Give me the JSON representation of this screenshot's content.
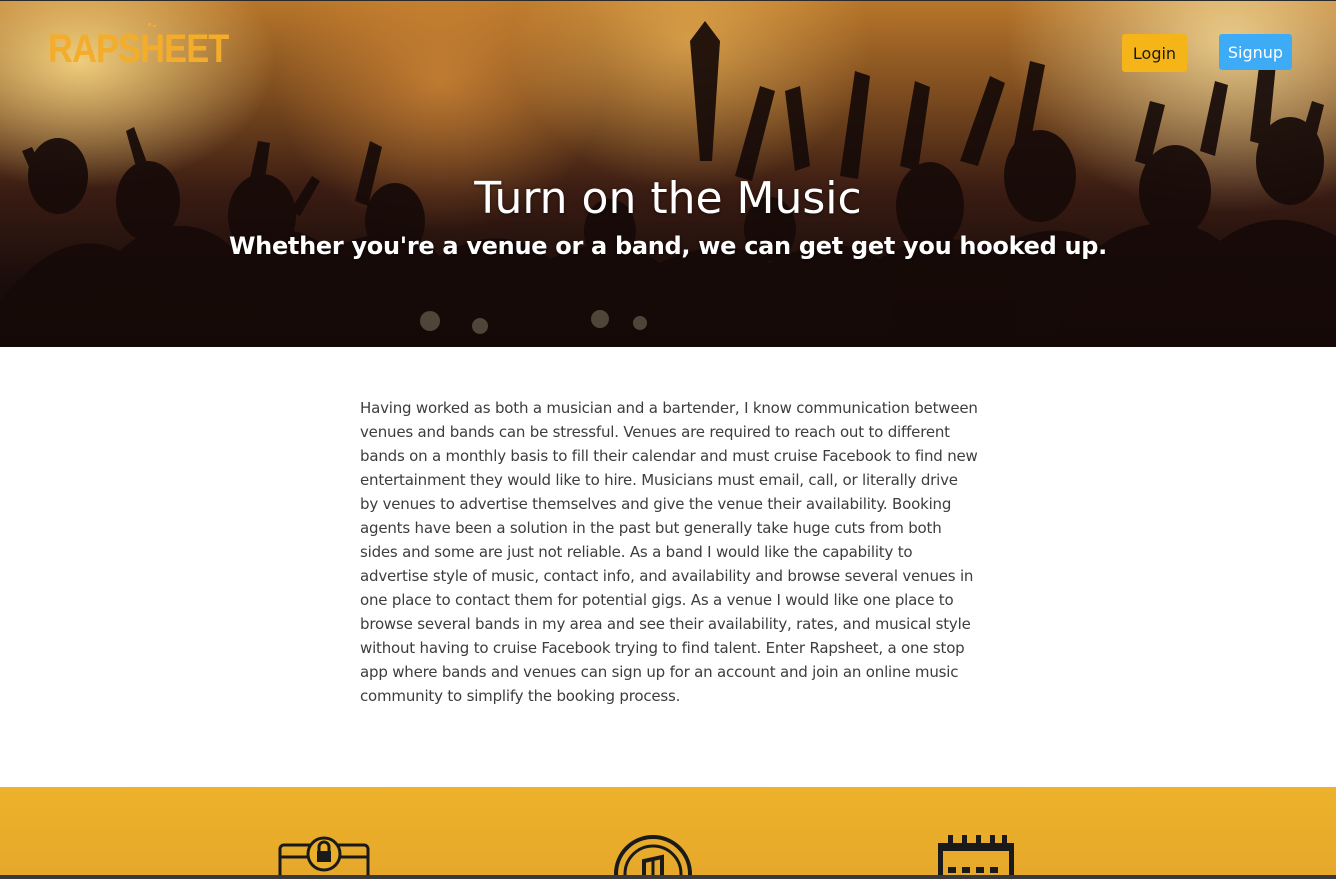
{
  "brand": {
    "logo_text": "RAPSHEET"
  },
  "nav": {
    "login_label": "Login",
    "signup_label": "Signup"
  },
  "hero": {
    "title": "Turn on the Music",
    "subtitle": "Whether you're a venue or a band, we can get get you hooked up."
  },
  "about": {
    "paragraph": "Having worked as both a musician and a bartender, I know communication between venues and bands can be stressful. Venues are required to reach out to different bands on a monthly basis to fill their calendar and must cruise Facebook to find new entertainment they would like to hire. Musicians must email, call, or literally drive by venues to advertise themselves and give the venue their availability. Booking agents have been a solution in the past but generally take huge cuts from both sides and some are just not reliable. As a band I would like the capability to advertise style of music, contact info, and availability and browse several venues in one place to contact them for potential gigs. As a venue I would like one place to browse several bands in my area and see their availability, rates, and musical style without having to cruise Facebook trying to find talent. Enter Rapsheet, a one stop app where bands and venues can sign up for an account and join an online music community to simplify the booking process."
  },
  "features": {
    "icons": [
      "secure-account-icon",
      "vinyl-record-icon",
      "calendar-icon"
    ]
  },
  "colors": {
    "brand_accent": "#f3ad2a",
    "login_button": "#f5b518",
    "signup_button": "#3dabf5",
    "feature_band": "#e9ad2a"
  }
}
